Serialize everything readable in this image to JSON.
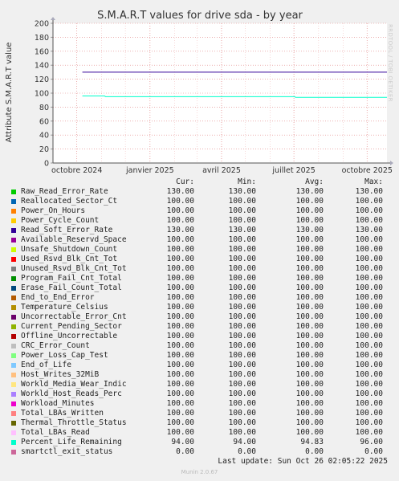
{
  "chart_data": {
    "type": "line",
    "title": "S.M.A.R.T values for drive sda - by year",
    "ylabel": "Attribute S.M.A.R.T value",
    "xlabel": "",
    "ylim": [
      0,
      200
    ],
    "yticks": [
      0,
      20,
      40,
      60,
      80,
      100,
      120,
      140,
      160,
      180,
      200
    ],
    "xlim": [
      "2024-09-01",
      "2025-10-26"
    ],
    "xticks": [
      {
        "label": "octobre 2024",
        "date": "2024-10-01"
      },
      {
        "label": "janvier 2025",
        "date": "2025-01-01"
      },
      {
        "label": "avril 2025",
        "date": "2025-04-01"
      },
      {
        "label": "juillet 2025",
        "date": "2025-07-01"
      },
      {
        "label": "octobre 2025",
        "date": "2025-10-01"
      }
    ],
    "grid": true,
    "side_text": "RRDTOOL / TOBI OETIKER",
    "series": [
      {
        "name": "Raw_Read_Error_Rate",
        "color": "#00cc00",
        "cur": "130.00",
        "min": "130.00",
        "avg": "130.00",
        "max": "130.00"
      },
      {
        "name": "Reallocated_Sector_Ct",
        "color": "#0066b3",
        "cur": "100.00",
        "min": "100.00",
        "avg": "100.00",
        "max": "100.00"
      },
      {
        "name": "Power_On_Hours",
        "color": "#ff8000",
        "cur": "100.00",
        "min": "100.00",
        "avg": "100.00",
        "max": "100.00"
      },
      {
        "name": "Power_Cycle_Count",
        "color": "#ffcc00",
        "cur": "100.00",
        "min": "100.00",
        "avg": "100.00",
        "max": "100.00"
      },
      {
        "name": "Read_Soft_Error_Rate",
        "color": "#330099",
        "cur": "130.00",
        "min": "130.00",
        "avg": "130.00",
        "max": "130.00"
      },
      {
        "name": "Available_Reservd_Space",
        "color": "#990099",
        "cur": "100.00",
        "min": "100.00",
        "avg": "100.00",
        "max": "100.00"
      },
      {
        "name": "Unsafe_Shutdown_Count",
        "color": "#ccff00",
        "cur": "100.00",
        "min": "100.00",
        "avg": "100.00",
        "max": "100.00"
      },
      {
        "name": "Used_Rsvd_Blk_Cnt_Tot",
        "color": "#ff0000",
        "cur": "100.00",
        "min": "100.00",
        "avg": "100.00",
        "max": "100.00"
      },
      {
        "name": "Unused_Rsvd_Blk_Cnt_Tot",
        "color": "#808080",
        "cur": "100.00",
        "min": "100.00",
        "avg": "100.00",
        "max": "100.00"
      },
      {
        "name": "Program_Fail_Cnt_Total",
        "color": "#008f00",
        "cur": "100.00",
        "min": "100.00",
        "avg": "100.00",
        "max": "100.00"
      },
      {
        "name": "Erase_Fail_Count_Total",
        "color": "#00487d",
        "cur": "100.00",
        "min": "100.00",
        "avg": "100.00",
        "max": "100.00"
      },
      {
        "name": "End_to_End_Error",
        "color": "#b35a00",
        "cur": "100.00",
        "min": "100.00",
        "avg": "100.00",
        "max": "100.00"
      },
      {
        "name": "Temperature_Celsius",
        "color": "#b38f00",
        "cur": "100.00",
        "min": "100.00",
        "avg": "100.00",
        "max": "100.00"
      },
      {
        "name": "Uncorrectable_Error_Cnt",
        "color": "#6b006b",
        "cur": "100.00",
        "min": "100.00",
        "avg": "100.00",
        "max": "100.00"
      },
      {
        "name": "Current_Pending_Sector",
        "color": "#8fb300",
        "cur": "100.00",
        "min": "100.00",
        "avg": "100.00",
        "max": "100.00"
      },
      {
        "name": "Offline_Uncorrectable",
        "color": "#b30000",
        "cur": "100.00",
        "min": "100.00",
        "avg": "100.00",
        "max": "100.00"
      },
      {
        "name": "CRC_Error_Count",
        "color": "#bebebe",
        "cur": "100.00",
        "min": "100.00",
        "avg": "100.00",
        "max": "100.00"
      },
      {
        "name": "Power_Loss_Cap_Test",
        "color": "#80ff80",
        "cur": "100.00",
        "min": "100.00",
        "avg": "100.00",
        "max": "100.00"
      },
      {
        "name": "End_of_Life",
        "color": "#80c9ff",
        "cur": "100.00",
        "min": "100.00",
        "avg": "100.00",
        "max": "100.00"
      },
      {
        "name": "Host_Writes_32MiB",
        "color": "#ffc080",
        "cur": "100.00",
        "min": "100.00",
        "avg": "100.00",
        "max": "100.00"
      },
      {
        "name": "Workld_Media_Wear_Indic",
        "color": "#ffe680",
        "cur": "100.00",
        "min": "100.00",
        "avg": "100.00",
        "max": "100.00"
      },
      {
        "name": "Workld_Host_Reads_Perc",
        "color": "#aa80ff",
        "cur": "100.00",
        "min": "100.00",
        "avg": "100.00",
        "max": "100.00"
      },
      {
        "name": "Workload_Minutes",
        "color": "#ee00cc",
        "cur": "100.00",
        "min": "100.00",
        "avg": "100.00",
        "max": "100.00"
      },
      {
        "name": "Total_LBAs_Written",
        "color": "#ff8080",
        "cur": "100.00",
        "min": "100.00",
        "avg": "100.00",
        "max": "100.00"
      },
      {
        "name": "Thermal_Throttle_Status",
        "color": "#666600",
        "cur": "100.00",
        "min": "100.00",
        "avg": "100.00",
        "max": "100.00"
      },
      {
        "name": "Total_LBAs_Read",
        "color": "#ffbfff",
        "cur": "100.00",
        "min": "100.00",
        "avg": "100.00",
        "max": "100.00"
      },
      {
        "name": "Percent_Life_Remaining",
        "color": "#00ffcc",
        "cur": "94.00",
        "min": "94.00",
        "avg": "94.83",
        "max": "96.00"
      },
      {
        "name": "smartctl_exit_status",
        "color": "#cc6699",
        "cur": "0.00",
        "min": "0.00",
        "avg": "0.00",
        "max": "0.00"
      }
    ],
    "lines": [
      {
        "series": "Read_Soft_Error_Rate",
        "color": "#330099",
        "points": [
          [
            "2024-10-08",
            130
          ],
          [
            "2025-10-26",
            130
          ]
        ]
      },
      {
        "series": "Percent_Life_Remaining",
        "color": "#00ffcc",
        "points": [
          [
            "2024-10-08",
            96
          ],
          [
            "2024-11-05",
            96
          ],
          [
            "2024-11-06",
            95
          ],
          [
            "2025-07-02",
            95
          ],
          [
            "2025-07-03",
            94
          ],
          [
            "2025-10-26",
            94
          ]
        ]
      },
      {
        "series": "smartctl_exit_status",
        "color": "#cc6699",
        "points": [
          [
            "2024-10-08",
            0
          ],
          [
            "2025-10-26",
            0
          ]
        ]
      }
    ]
  },
  "legend": {
    "headers": {
      "cur": "Cur:",
      "min": "Min:",
      "avg": "Avg:",
      "max": "Max:"
    }
  },
  "footer": {
    "last_update": "Last update: Sun Oct 26 02:05:22 2025",
    "version": "Munin 2.0.67"
  }
}
